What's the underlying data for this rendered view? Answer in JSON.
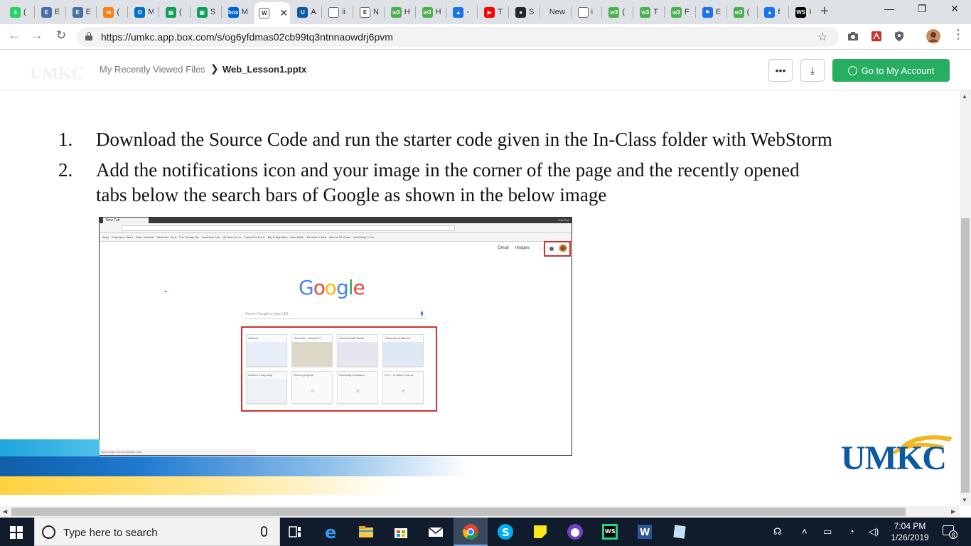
{
  "browser": {
    "tabs": [
      {
        "icon": "whatsapp-icon",
        "letter": "4",
        "color": "#25d366",
        "label": "("
      },
      {
        "icon": "e-icon",
        "letter": "E",
        "color": "#4a6ea8",
        "label": "E"
      },
      {
        "icon": "e-icon",
        "letter": "E",
        "color": "#4a6ea8",
        "label": "E"
      },
      {
        "icon": "moodle-icon",
        "letter": "m",
        "color": "#f98012",
        "label": "("
      },
      {
        "icon": "outlook-icon",
        "letter": "O",
        "color": "#0072c6",
        "label": "M"
      },
      {
        "icon": "sheets-icon",
        "letter": "▦",
        "color": "#0f9d58",
        "label": "("
      },
      {
        "icon": "sheets-icon",
        "letter": "▦",
        "color": "#0f9d58",
        "label": "S"
      },
      {
        "icon": "box-icon",
        "letter": "box",
        "color": "#0061d5",
        "label": "M"
      },
      {
        "icon": "w-icon",
        "letter": "W",
        "color": "#ffffff",
        "label": "Web_Lesson1.pptx"
      },
      {
        "icon": "umkc-icon",
        "letter": "U",
        "color": "#0a5aa3",
        "label": "A"
      },
      {
        "icon": "document-icon",
        "letter": "",
        "color": "#ffffff",
        "label": "ii"
      },
      {
        "icon": "e-icon",
        "letter": "E",
        "color": "#ffffff",
        "label": "N"
      },
      {
        "icon": "w3schools-icon",
        "letter": "w3",
        "color": "#4caf50",
        "label": "H"
      },
      {
        "icon": "w3schools-icon",
        "letter": "w3",
        "color": "#4caf50",
        "label": "H"
      },
      {
        "icon": "graduation-cap-icon",
        "letter": "▲",
        "color": "#1a73e8",
        "label": "-"
      },
      {
        "icon": "youtube-icon",
        "letter": "▶",
        "color": "#ff0000",
        "label": "T"
      },
      {
        "icon": "github-icon",
        "letter": "●",
        "color": "#24292e",
        "label": "S"
      },
      {
        "icon": "new-tab-icon",
        "letter": "",
        "color": "#dee1e6",
        "label": "New"
      },
      {
        "icon": "document-icon",
        "letter": "",
        "color": "#ffffff",
        "label": "i"
      },
      {
        "icon": "w3schools-icon",
        "letter": "w3",
        "color": "#4caf50",
        "label": "("
      },
      {
        "icon": "w3schools-icon",
        "letter": "w3",
        "color": "#4caf50",
        "label": "T"
      },
      {
        "icon": "w3schools-icon",
        "letter": "w3",
        "color": "#4caf50",
        "label": "F"
      },
      {
        "icon": "flag-icon",
        "letter": "⚑",
        "color": "#1a73e8",
        "label": "E"
      },
      {
        "icon": "w3schools-icon",
        "letter": "w3",
        "color": "#4caf50",
        "label": "("
      },
      {
        "icon": "graduation-cap-icon",
        "letter": "▲",
        "color": "#1a73e8",
        "label": "f"
      },
      {
        "icon": "webstorm-icon",
        "letter": "WS",
        "color": "#000000",
        "label": "I"
      }
    ],
    "active_tab_index": 8,
    "new_tab_label": "+",
    "url": "https://umkc.app.box.com/s/og6yfdmas02cb99tq3ntnnaowdrj6pvm"
  },
  "box": {
    "logo_text": "UMKC",
    "breadcrumb_parent": "My Recently Viewed Files",
    "breadcrumb_current": "Web_Lesson1.pptx",
    "more_label": "•••",
    "download_label": "⤓",
    "account_button": "Go to My Account"
  },
  "slide": {
    "steps": [
      {
        "num": "1.",
        "lines": [
          "Download the Source Code and run the starter code given in the In-Class folder with WebStorm"
        ]
      },
      {
        "num": "2.",
        "lines": [
          "Add the notifications icon and your image in the corner of the page and the recently opened",
          "tabs below the search bars of Google as shown in the below image"
        ]
      }
    ],
    "logo_text": "UMKC",
    "embedded": {
      "tab_title": "New Tab",
      "clock": "3:42 PM",
      "bookmarks": [
        "Apps",
        "Employee: Tasks",
        "Mail - Vuedola",
        "Welcome, Kurti",
        "The Ternary Op",
        "Vocareum Lab",
        "(1) How do I lo",
        "LaunchCode's C",
        "Big O Algorithm",
        "New folder",
        "Become a Web",
        "Intro to JS: Draw",
        "JavaScript | Coo"
      ],
      "gmail": "Gmail",
      "images": "Images",
      "google_letters": [
        {
          "ch": "G",
          "color": "#4285f4"
        },
        {
          "ch": "o",
          "color": "#ea4335"
        },
        {
          "ch": "o",
          "color": "#fbbc05"
        },
        {
          "ch": "g",
          "color": "#4285f4"
        },
        {
          "ch": "l",
          "color": "#34a853"
        },
        {
          "ch": "e",
          "color": "#ea4335"
        }
      ],
      "search_placeholder": "Search Google or type URL",
      "tiles": [
        {
          "title": "Outlook",
          "thumb": "#e8eef7"
        },
        {
          "title": "Overview - Guided Pr",
          "thumb": "#dcd8c8"
        },
        {
          "title": "Connect with Ticket",
          "thumb": "#e8e4f0"
        },
        {
          "title": "University of Missou",
          "thumb": "#dfe9f5"
        },
        {
          "title": "Student Computing",
          "thumb": "#eef2f6"
        },
        {
          "title": "Recent projects",
          "thumb": "#fafafa"
        },
        {
          "title": "University of Missou",
          "thumb": "#fafafa"
        },
        {
          "title": "FCC - Is Starer Course",
          "thumb": "#fafafa"
        }
      ],
      "status_text": "https://login.microsoftonline.com"
    }
  },
  "taskbar": {
    "search_placeholder": "Type here to search",
    "time": "7:04 PM",
    "date": "1/26/2019",
    "notification_count": "8"
  }
}
